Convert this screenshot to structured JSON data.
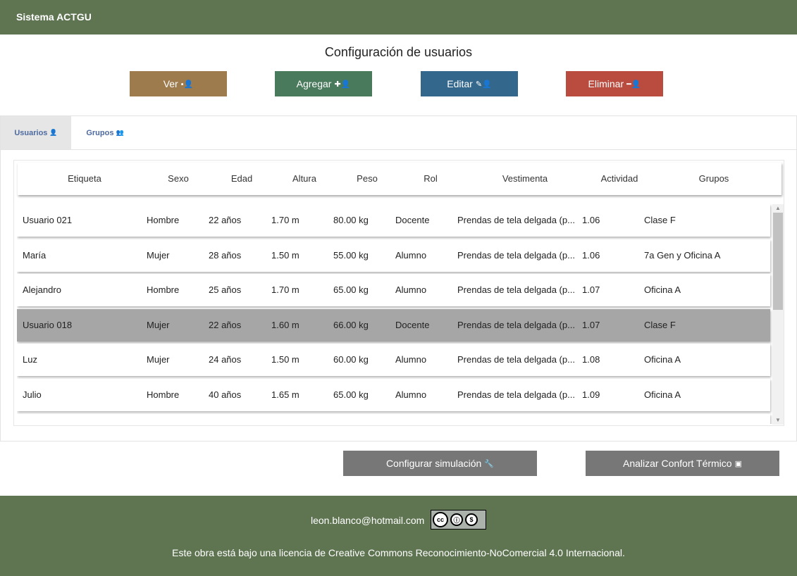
{
  "app": {
    "title": "Sistema ACTGU"
  },
  "page": {
    "title": "Configuración de usuarios"
  },
  "actions": [
    {
      "label": "Ver",
      "icon": "save-user-icon",
      "glyph": "▪",
      "color": "#9e7b4d"
    },
    {
      "label": "Agregar",
      "icon": "plus-user-icon",
      "glyph": "✚",
      "color": "#4a7a5c"
    },
    {
      "label": "Editar",
      "icon": "pencil-user-icon",
      "glyph": "✎",
      "color": "#33678b"
    },
    {
      "label": "Eliminar",
      "icon": "minus-user-icon",
      "glyph": "━",
      "color": "#b94c3f"
    }
  ],
  "tabs": [
    {
      "label": "Usuarios",
      "icon": "user-icon",
      "active": true
    },
    {
      "label": "Grupos",
      "icon": "users-icon",
      "active": false
    }
  ],
  "table": {
    "columns": [
      "Etiqueta",
      "Sexo",
      "Edad",
      "Altura",
      "Peso",
      "Rol",
      "Vestimenta",
      "Actividad",
      "Grupos"
    ],
    "rows": [
      {
        "cells": [
          "Usuario 021",
          "Hombre",
          "22 años",
          "1.70 m",
          "80.00 kg",
          "Docente",
          "Prendas de tela delgada (p...",
          "1.06",
          "Clase F"
        ],
        "selected": false
      },
      {
        "cells": [
          "María",
          "Mujer",
          "28 años",
          "1.50 m",
          "55.00 kg",
          "Alumno",
          "Prendas de tela delgada (p...",
          "1.06",
          "7a Gen y Oficina A"
        ],
        "selected": false
      },
      {
        "cells": [
          "Alejandro",
          "Hombre",
          "25 años",
          "1.70 m",
          "65.00 kg",
          "Alumno",
          "Prendas de tela delgada (p...",
          "1.07",
          "Oficina A"
        ],
        "selected": false
      },
      {
        "cells": [
          "Usuario 018",
          "Mujer",
          "22 años",
          "1.60 m",
          "66.00 kg",
          "Docente",
          "Prendas de tela delgada (p...",
          "1.07",
          "Clase F"
        ],
        "selected": true
      },
      {
        "cells": [
          "Luz",
          "Mujer",
          "24 años",
          "1.50 m",
          "60.00 kg",
          "Alumno",
          "Prendas de tela delgada (p...",
          "1.08",
          "Oficina A"
        ],
        "selected": false
      },
      {
        "cells": [
          "Julio",
          "Hombre",
          "40 años",
          "1.65 m",
          "65.00 kg",
          "Alumno",
          "Prendas de tela delgada (p...",
          "1.09",
          "Oficina A"
        ],
        "selected": false
      }
    ]
  },
  "bottom_actions": [
    {
      "label": "Configurar simulación",
      "icon": "wrench-icon",
      "glyph": "🔧"
    },
    {
      "label": "Analizar Confort Térmico",
      "icon": "chart-icon",
      "glyph": "▣"
    }
  ],
  "footer": {
    "email": "leon.blanco@hotmail.com",
    "badge": {
      "cc": "cc",
      "by": "BY",
      "nc": "NC"
    },
    "license": "Este obra está bajo una licencia de Creative Commons Reconocimiento-NoComercial 4.0 Internacional."
  },
  "colors": {
    "header": "#5f7552",
    "selected_row": "#a6a6a6",
    "tab_text": "#4d6aa0",
    "bottom_button": "#777777"
  }
}
